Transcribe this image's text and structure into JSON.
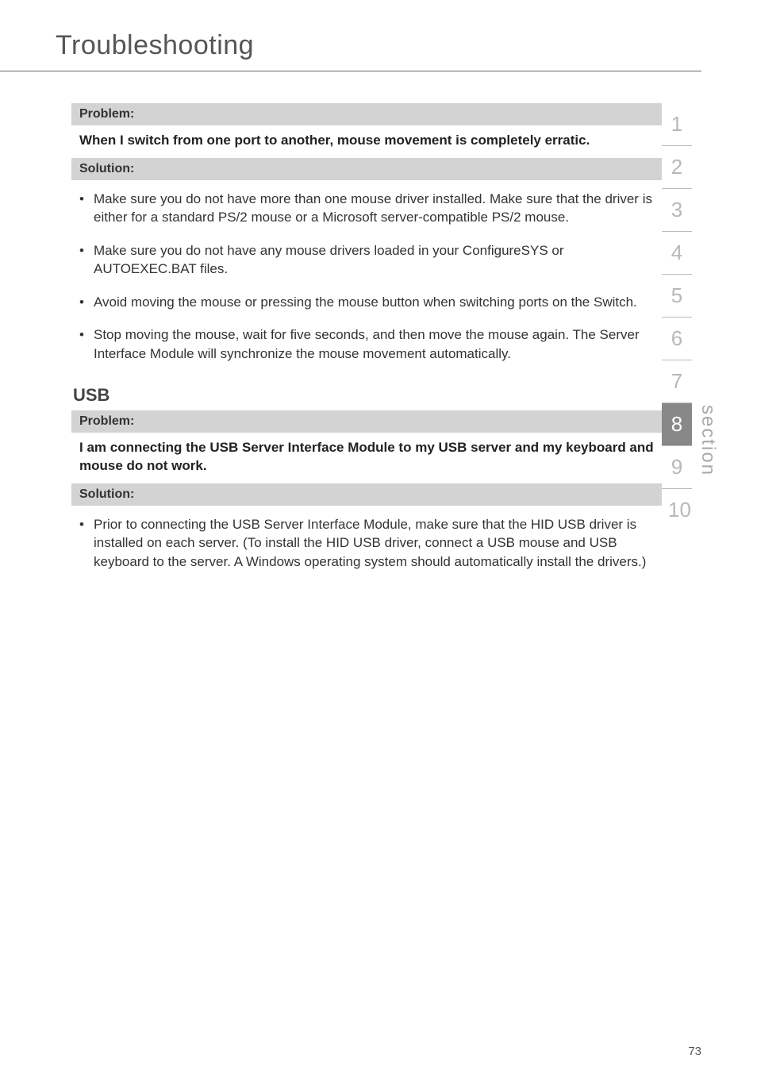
{
  "title": "Troubleshooting",
  "block1": {
    "problem_header": "Problem:",
    "problem_text": "When I switch from one port to another, mouse movement is completely erratic.",
    "solution_header": "Solution:",
    "bullets": [
      "Make sure you do not have more than one mouse driver installed. Make sure that the driver is either for a standard PS/2 mouse or a Microsoft server-compatible PS/2 mouse.",
      "Make sure you do not have any mouse drivers loaded in your ConfigureSYS or AUTOEXEC.BAT files.",
      "Avoid moving the mouse or pressing the mouse button when switching ports on the Switch.",
      "Stop moving the mouse, wait for five seconds, and then move the mouse again. The Server Interface Module will synchronize the mouse movement automatically."
    ]
  },
  "usb_heading": "USB",
  "block2": {
    "problem_header": "Problem:",
    "problem_text": "I am connecting the USB Server Interface Module to my USB server and my keyboard and mouse do not work.",
    "solution_header": "Solution:",
    "bullets": [
      "Prior to connecting the USB Server Interface Module, make sure that the HID USB driver is installed on each server. (To install the HID USB driver, connect a USB mouse and USB keyboard to the server. A Windows operating system should automatically install the drivers.)"
    ]
  },
  "sidebar": {
    "nums": [
      "1",
      "2",
      "3",
      "4",
      "5",
      "6",
      "7",
      "8",
      "9",
      "10"
    ],
    "active": "8",
    "label": "section"
  },
  "page_number": "73"
}
